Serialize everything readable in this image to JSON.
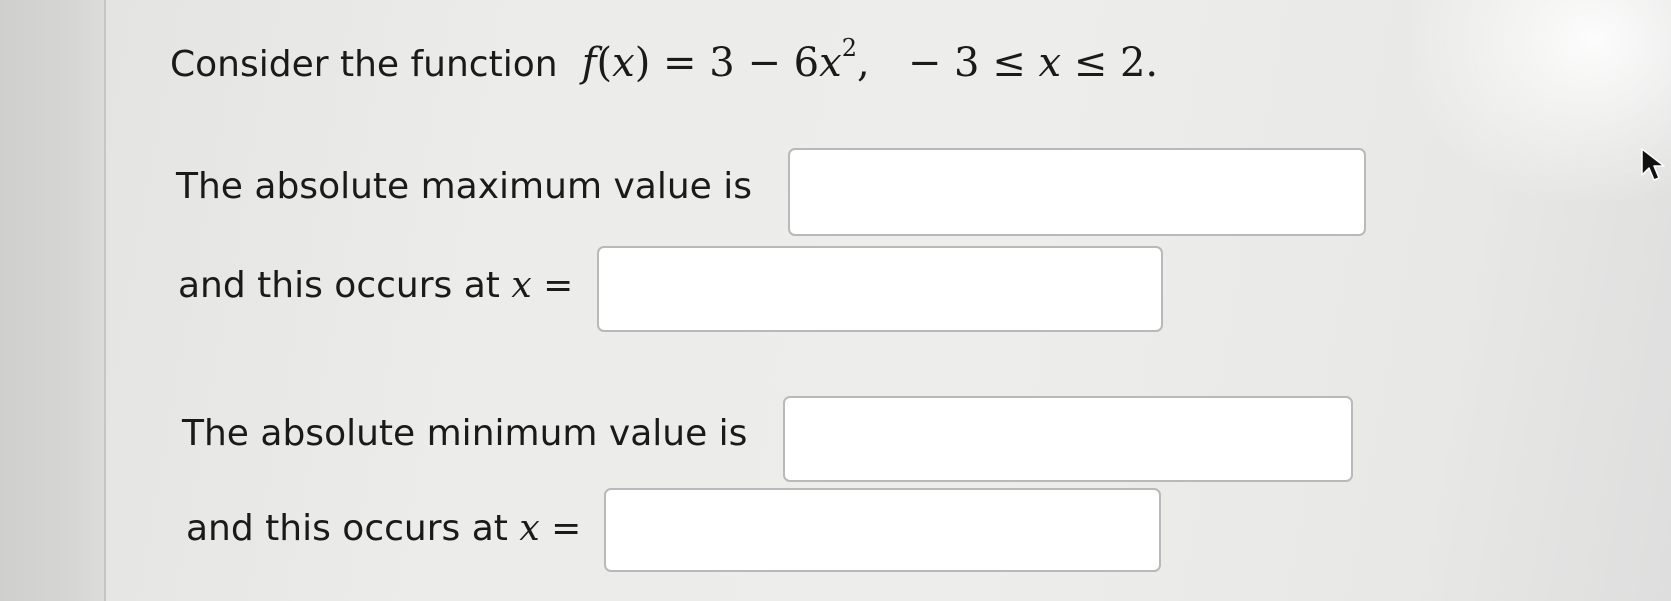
{
  "question": {
    "prefix": "Consider the function",
    "f": "f",
    "var": "x",
    "expr_const": "3 − 6",
    "exponent": "2",
    "domain_left": "− 3 ≤",
    "domain_right": "≤ 2."
  },
  "rows": [
    {
      "label": "The absolute maximum value is",
      "value": ""
    },
    {
      "label": "and this occurs at",
      "var": "x",
      "eq": "=",
      "value": ""
    },
    {
      "label": "The absolute minimum value is",
      "value": ""
    },
    {
      "label": "and this occurs at",
      "var": "x",
      "eq": "=",
      "value": ""
    }
  ]
}
